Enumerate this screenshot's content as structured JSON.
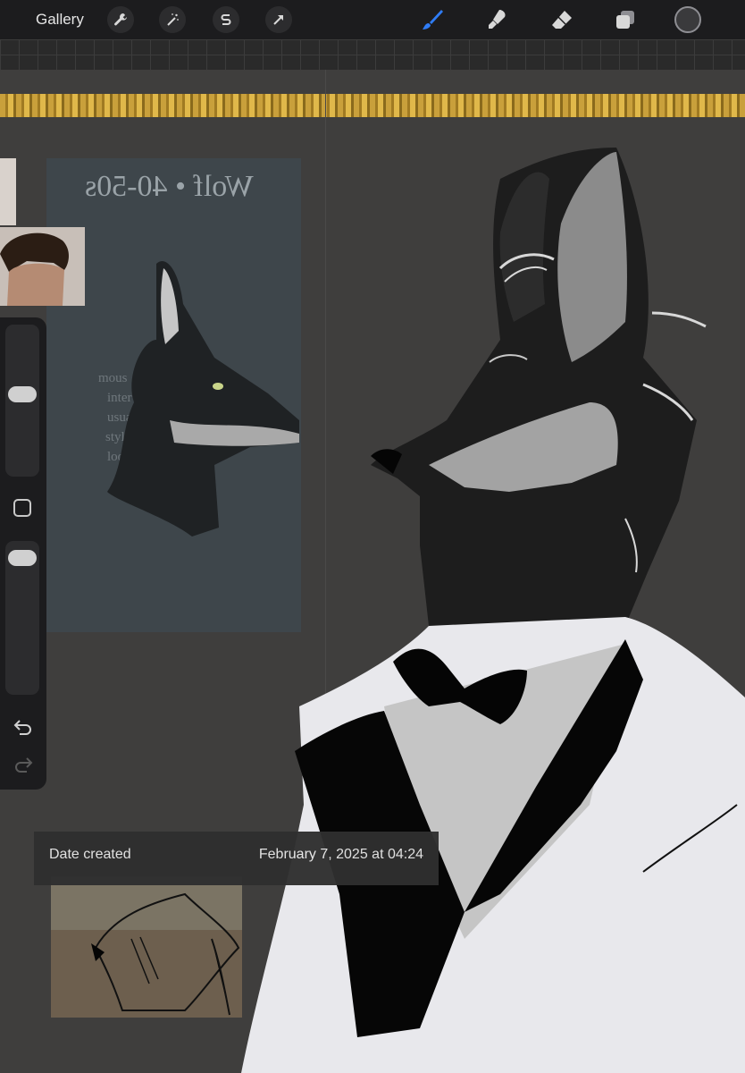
{
  "toolbar": {
    "gallery_label": "Gallery",
    "left_icons": [
      "wrench-icon",
      "magic-wand-icon",
      "selection-icon",
      "transform-arrow-icon"
    ],
    "right_icons": [
      "brush-icon",
      "smudge-icon",
      "eraser-icon",
      "layers-icon",
      "color-icon"
    ],
    "active_tool": "brush",
    "accent_color": "#2f7cf6"
  },
  "reference": {
    "title": "Wolf • 40-50s",
    "text_lines": [
      "mous",
      "inter",
      "usua",
      "style th",
      "look"
    ]
  },
  "sidebar": {
    "brush_size_level": 0.55,
    "opacity_level": 0.95
  },
  "info": {
    "label": "Date created",
    "value": "February 7, 2025 at 04:24"
  }
}
